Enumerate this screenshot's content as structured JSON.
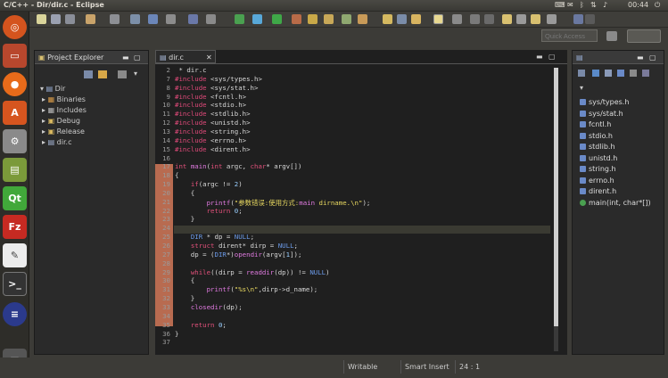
{
  "window": {
    "title": "C/C++ - Dir/dir.c - Eclipse"
  },
  "tray": {
    "clock": "00:44"
  },
  "toolbar": {
    "quick_access_placeholder": "Quick Access"
  },
  "project_explorer": {
    "tab_label": "Project Explorer",
    "root": "Dir",
    "items": [
      "Binaries",
      "Includes",
      "Debug",
      "Release",
      "dir.c"
    ]
  },
  "editor": {
    "tab_label": "dir.c",
    "lines": [
      {
        "n": "2",
        "text": " * dir.c"
      },
      {
        "n": "7",
        "text": "#include <sys/types.h>"
      },
      {
        "n": "8",
        "text": "#include <sys/stat.h>"
      },
      {
        "n": "9",
        "text": "#include <fcntl.h>"
      },
      {
        "n": "10",
        "text": "#include <stdio.h>"
      },
      {
        "n": "11",
        "text": "#include <stdlib.h>"
      },
      {
        "n": "12",
        "text": "#include <unistd.h>"
      },
      {
        "n": "13",
        "text": "#include <string.h>"
      },
      {
        "n": "14",
        "text": "#include <errno.h>"
      },
      {
        "n": "15",
        "text": "#include <dirent.h>"
      },
      {
        "n": "16",
        "text": ""
      },
      {
        "n": "17",
        "text": "int main(int argc, char* argv[])"
      },
      {
        "n": "18",
        "text": "{"
      },
      {
        "n": "19",
        "text": "    if(argc != 2)"
      },
      {
        "n": "20",
        "text": "    {"
      },
      {
        "n": "21",
        "text": "        printf(\"参数错误:使用方式:main dirname.\\n\");"
      },
      {
        "n": "22",
        "text": "        return 0;"
      },
      {
        "n": "23",
        "text": "    }"
      },
      {
        "n": "24",
        "text": ""
      },
      {
        "n": "25",
        "text": "    DIR * dp = NULL;"
      },
      {
        "n": "26",
        "text": "    struct dirent* dirp = NULL;"
      },
      {
        "n": "27",
        "text": "    dp = (DIR*)opendir(argv[1]);"
      },
      {
        "n": "28",
        "text": ""
      },
      {
        "n": "29",
        "text": "    while((dirp = readdir(dp)) != NULL)"
      },
      {
        "n": "30",
        "text": "    {"
      },
      {
        "n": "31",
        "text": "        printf(\"%s\\n\",dirp->d_name);"
      },
      {
        "n": "32",
        "text": "    }"
      },
      {
        "n": "33",
        "text": "    closedir(dp);"
      },
      {
        "n": "34",
        "text": ""
      },
      {
        "n": "35",
        "text": "    return 0;"
      },
      {
        "n": "36",
        "text": "}"
      },
      {
        "n": "37",
        "text": ""
      }
    ]
  },
  "outline": {
    "items": [
      "sys/types.h",
      "sys/stat.h",
      "fcntl.h",
      "stdio.h",
      "stdlib.h",
      "unistd.h",
      "string.h",
      "errno.h",
      "dirent.h",
      "main(int, char*[])"
    ]
  },
  "status": {
    "writable": "Writable",
    "insert_mode": "Smart Insert",
    "position": "24 : 1"
  },
  "colors": {
    "launcher_bg": "#2e2d29",
    "editor_bg": "#1f1f1f",
    "keyword": "#e0507a",
    "string": "#e8d860",
    "current_line": "#3a3a32"
  }
}
